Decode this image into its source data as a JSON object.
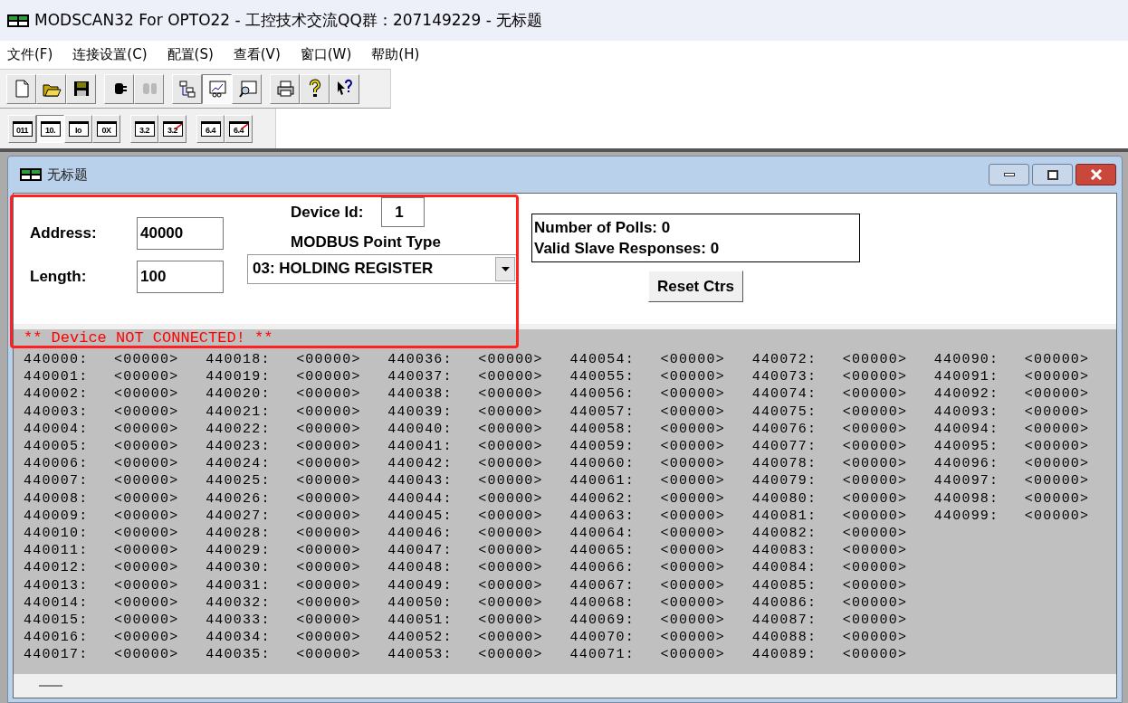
{
  "window": {
    "title": "MODSCAN32 For OPTO22 - 工控技术交流QQ群：207149229 - 无标题"
  },
  "menu": [
    "文件(F)",
    "连接设置(C)",
    "配置(S)",
    "查看(V)",
    "窗口(W)",
    "帮助(H)"
  ],
  "toolbar": [
    {
      "kind": "new",
      "selected": false,
      "disabled": false
    },
    {
      "kind": "open",
      "selected": false,
      "disabled": false
    },
    {
      "kind": "save",
      "selected": false,
      "disabled": false
    },
    {
      "kind": "connect",
      "selected": false,
      "disabled": false
    },
    {
      "kind": "disconnect",
      "selected": false,
      "disabled": true
    },
    {
      "kind": "tree",
      "selected": false,
      "disabled": false
    },
    {
      "kind": "graph",
      "selected": true,
      "disabled": false
    },
    {
      "kind": "inspect",
      "selected": false,
      "disabled": false
    },
    {
      "kind": "print",
      "selected": false,
      "disabled": false
    },
    {
      "kind": "help",
      "selected": false,
      "disabled": false
    },
    {
      "kind": "context-help",
      "selected": false,
      "disabled": false
    }
  ],
  "format_toolbar": [
    {
      "label": "011",
      "selected": false,
      "struck": false
    },
    {
      "label": "10.",
      "selected": true,
      "struck": false
    },
    {
      "label": "Io",
      "selected": false,
      "struck": false
    },
    {
      "label": "0X",
      "selected": false,
      "struck": false
    },
    {
      "label": "3.2",
      "selected": false,
      "struck": false
    },
    {
      "label": "3.2",
      "selected": false,
      "struck": true
    },
    {
      "label": "6.4",
      "selected": false,
      "struck": false
    },
    {
      "label": "6.4",
      "selected": false,
      "struck": true
    }
  ],
  "child_window": {
    "title": "无标题"
  },
  "form": {
    "address_label": "Address:",
    "address": "40000",
    "length_label": "Length:",
    "length": "100",
    "device_id_label": "Device Id:",
    "device_id": "1",
    "point_type_label": "MODBUS Point Type",
    "point_type": "03: HOLDING REGISTER"
  },
  "counters": {
    "polls": "Number of Polls: 0",
    "responses": "Valid Slave Responses: 0",
    "reset_button": "Reset Ctrs"
  },
  "status_message": "** Device NOT CONNECTED! **",
  "registers": [
    {
      "address": "440000:",
      "value": "<00000>"
    },
    {
      "address": "440001:",
      "value": "<00000>"
    },
    {
      "address": "440002:",
      "value": "<00000>"
    },
    {
      "address": "440003:",
      "value": "<00000>"
    },
    {
      "address": "440004:",
      "value": "<00000>"
    },
    {
      "address": "440005:",
      "value": "<00000>"
    },
    {
      "address": "440006:",
      "value": "<00000>"
    },
    {
      "address": "440007:",
      "value": "<00000>"
    },
    {
      "address": "440008:",
      "value": "<00000>"
    },
    {
      "address": "440009:",
      "value": "<00000>"
    },
    {
      "address": "440010:",
      "value": "<00000>"
    },
    {
      "address": "440011:",
      "value": "<00000>"
    },
    {
      "address": "440012:",
      "value": "<00000>"
    },
    {
      "address": "440013:",
      "value": "<00000>"
    },
    {
      "address": "440014:",
      "value": "<00000>"
    },
    {
      "address": "440015:",
      "value": "<00000>"
    },
    {
      "address": "440016:",
      "value": "<00000>"
    },
    {
      "address": "440017:",
      "value": "<00000>"
    },
    {
      "address": "440018:",
      "value": "<00000>"
    },
    {
      "address": "440019:",
      "value": "<00000>"
    },
    {
      "address": "440020:",
      "value": "<00000>"
    },
    {
      "address": "440021:",
      "value": "<00000>"
    },
    {
      "address": "440022:",
      "value": "<00000>"
    },
    {
      "address": "440023:",
      "value": "<00000>"
    },
    {
      "address": "440024:",
      "value": "<00000>"
    },
    {
      "address": "440025:",
      "value": "<00000>"
    },
    {
      "address": "440026:",
      "value": "<00000>"
    },
    {
      "address": "440027:",
      "value": "<00000>"
    },
    {
      "address": "440028:",
      "value": "<00000>"
    },
    {
      "address": "440029:",
      "value": "<00000>"
    },
    {
      "address": "440030:",
      "value": "<00000>"
    },
    {
      "address": "440031:",
      "value": "<00000>"
    },
    {
      "address": "440032:",
      "value": "<00000>"
    },
    {
      "address": "440033:",
      "value": "<00000>"
    },
    {
      "address": "440034:",
      "value": "<00000>"
    },
    {
      "address": "440035:",
      "value": "<00000>"
    },
    {
      "address": "440036:",
      "value": "<00000>"
    },
    {
      "address": "440037:",
      "value": "<00000>"
    },
    {
      "address": "440038:",
      "value": "<00000>"
    },
    {
      "address": "440039:",
      "value": "<00000>"
    },
    {
      "address": "440040:",
      "value": "<00000>"
    },
    {
      "address": "440041:",
      "value": "<00000>"
    },
    {
      "address": "440042:",
      "value": "<00000>"
    },
    {
      "address": "440043:",
      "value": "<00000>"
    },
    {
      "address": "440044:",
      "value": "<00000>"
    },
    {
      "address": "440045:",
      "value": "<00000>"
    },
    {
      "address": "440046:",
      "value": "<00000>"
    },
    {
      "address": "440047:",
      "value": "<00000>"
    },
    {
      "address": "440048:",
      "value": "<00000>"
    },
    {
      "address": "440049:",
      "value": "<00000>"
    },
    {
      "address": "440050:",
      "value": "<00000>"
    },
    {
      "address": "440051:",
      "value": "<00000>"
    },
    {
      "address": "440052:",
      "value": "<00000>"
    },
    {
      "address": "440053:",
      "value": "<00000>"
    },
    {
      "address": "440054:",
      "value": "<00000>"
    },
    {
      "address": "440055:",
      "value": "<00000>"
    },
    {
      "address": "440056:",
      "value": "<00000>"
    },
    {
      "address": "440057:",
      "value": "<00000>"
    },
    {
      "address": "440058:",
      "value": "<00000>"
    },
    {
      "address": "440059:",
      "value": "<00000>"
    },
    {
      "address": "440060:",
      "value": "<00000>"
    },
    {
      "address": "440061:",
      "value": "<00000>"
    },
    {
      "address": "440062:",
      "value": "<00000>"
    },
    {
      "address": "440063:",
      "value": "<00000>"
    },
    {
      "address": "440064:",
      "value": "<00000>"
    },
    {
      "address": "440065:",
      "value": "<00000>"
    },
    {
      "address": "440066:",
      "value": "<00000>"
    },
    {
      "address": "440067:",
      "value": "<00000>"
    },
    {
      "address": "440068:",
      "value": "<00000>"
    },
    {
      "address": "440069:",
      "value": "<00000>"
    },
    {
      "address": "440070:",
      "value": "<00000>"
    },
    {
      "address": "440071:",
      "value": "<00000>"
    },
    {
      "address": "440072:",
      "value": "<00000>"
    },
    {
      "address": "440073:",
      "value": "<00000>"
    },
    {
      "address": "440074:",
      "value": "<00000>"
    },
    {
      "address": "440075:",
      "value": "<00000>"
    },
    {
      "address": "440076:",
      "value": "<00000>"
    },
    {
      "address": "440077:",
      "value": "<00000>"
    },
    {
      "address": "440078:",
      "value": "<00000>"
    },
    {
      "address": "440079:",
      "value": "<00000>"
    },
    {
      "address": "440080:",
      "value": "<00000>"
    },
    {
      "address": "440081:",
      "value": "<00000>"
    },
    {
      "address": "440082:",
      "value": "<00000>"
    },
    {
      "address": "440083:",
      "value": "<00000>"
    },
    {
      "address": "440084:",
      "value": "<00000>"
    },
    {
      "address": "440085:",
      "value": "<00000>"
    },
    {
      "address": "440086:",
      "value": "<00000>"
    },
    {
      "address": "440087:",
      "value": "<00000>"
    },
    {
      "address": "440088:",
      "value": "<00000>"
    },
    {
      "address": "440089:",
      "value": "<00000>"
    },
    {
      "address": "440090:",
      "value": "<00000>"
    },
    {
      "address": "440091:",
      "value": "<00000>"
    },
    {
      "address": "440092:",
      "value": "<00000>"
    },
    {
      "address": "440093:",
      "value": "<00000>"
    },
    {
      "address": "440094:",
      "value": "<00000>"
    },
    {
      "address": "440095:",
      "value": "<00000>"
    },
    {
      "address": "440096:",
      "value": "<00000>"
    },
    {
      "address": "440097:",
      "value": "<00000>"
    },
    {
      "address": "440098:",
      "value": "<00000>"
    },
    {
      "address": "440099:",
      "value": "<00000>"
    }
  ]
}
